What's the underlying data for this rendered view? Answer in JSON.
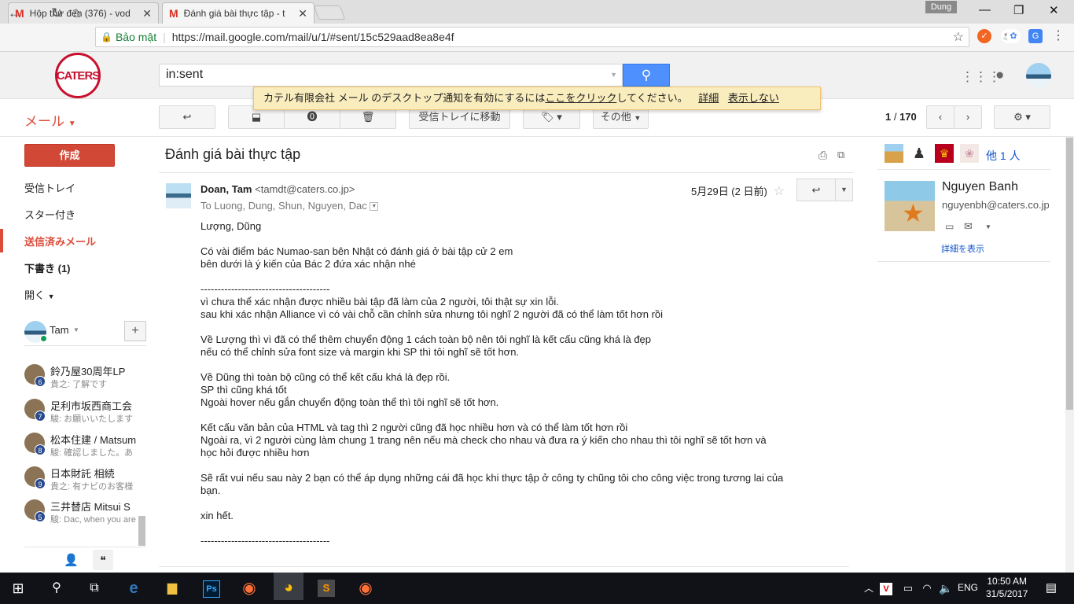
{
  "browser": {
    "tabs": [
      {
        "title": "Hộp thư đến (376) - vod",
        "active": false
      },
      {
        "title": "Đánh giá bài thực tập - t",
        "active": true
      }
    ],
    "user_chip": "Dung",
    "security_label": "Bảo mật",
    "url": "https://mail.google.com/mail/u/1/#sent/15c529aad8ea8e4f"
  },
  "gmail": {
    "logo_text": "CATERS",
    "search_value": "in:sent",
    "notification": {
      "text_before": "カテル有限会社 メール のデスクトップ通知を有効にするには",
      "link": "ここをクリック",
      "text_after": "してください。",
      "details": "詳細",
      "dismiss": "表示しない"
    },
    "mail_menu": "メール",
    "toolbar": {
      "move_inbox": "受信トレイに移動",
      "more": "その他",
      "pager_current": "1",
      "pager_sep": " / ",
      "pager_total": "170"
    },
    "nav": {
      "compose": "作成",
      "inbox": "受信トレイ",
      "starred": "スター付き",
      "sent": "送信済みメール",
      "drafts": "下書き (1)",
      "more": "開く"
    },
    "hangouts": {
      "me": "Tam",
      "chats": [
        {
          "name": "鈴乃屋30周年LP",
          "snippet": "貴之: 了解です",
          "count": "6"
        },
        {
          "name": "足利市坂西商工会",
          "snippet": "駿: お願いいたします",
          "count": "7"
        },
        {
          "name": "松本住建 / Matsum",
          "snippet": "駿: 確認しました。あ",
          "count": "8"
        },
        {
          "name": "日本財託 相続",
          "snippet": "貴之: 有ナビのお客様",
          "count": "9"
        },
        {
          "name": "三井替店 Mitsui S",
          "snippet": "駿: Dac, when you are",
          "count": "5"
        }
      ]
    },
    "message": {
      "subject": "Đánh giá bài thực tập",
      "from_name": "Doan, Tam",
      "from_email": "<tamdt@caters.co.jp>",
      "to": "To Luong, Dung, Shun, Nguyen, Dac",
      "date": "5月29日 (2 日前)",
      "body_lines": [
        "Lượng, Dũng",
        "",
        "Có vài điểm bác Numao-san bên Nhật có đánh giá ở bài tập cử 2 em",
        "bên dưới là ý kiến của Bác 2 đứa xác nhận nhé",
        "",
        "--------------------------------------",
        "vì chưa thể xác nhận được nhiều bài tập đã làm của 2 người, tôi thật sự xin lỗi.",
        "sau khi xác nhận Alliance vì có vài chỗ cần chỉnh sửa nhưng tôi nghĩ 2 người đã có thể làm tốt hơn rồi",
        "",
        "Về Lượng thì vì đã có thể thêm chuyển động 1 cách toàn bộ nên tôi nghĩ là kết cấu cũng khá là đẹp",
        "nếu có thể chỉnh sửa font size và margin khi SP thì tôi nghĩ sẽ tốt hơn.",
        "",
        "Về Dũng thì toàn bộ cũng có thể kết cấu khá là đẹp rồi.",
        "SP thì cũng khá tốt",
        "Ngoài hover nếu gắn chuyển động toàn thể thì tôi nghĩ sẽ tốt hơn.",
        "",
        "Kết cấu văn bản của HTML và tag thì 2 người cũng đã học nhiều hơn và có thể làm tốt hơn rồi",
        "Ngoài ra, vì 2 người cùng làm chung 1 trang nên nếu mà check cho nhau và đưa ra ý kiến cho nhau thì tôi nghĩ sẽ tốt hơn và",
        "học hỏi được nhiều hơn",
        "",
        "Sẽ rất vui nếu sau này 2 bạn có thể áp dụng những cái đã học khi thực tập ở công ty chũng tôi cho công việc trong tương lai của",
        "bạn.",
        "",
        "xin hết.",
        "",
        "--------------------------------------"
      ]
    },
    "people_panel": {
      "more_people": "他 1 人",
      "name": "Nguyen Banh",
      "email": "nguyenbh@caters.co.jp",
      "details_link": "詳細を表示"
    }
  },
  "taskbar": {
    "language": "ENG",
    "time": "10:50 AM",
    "date": "31/5/2017"
  }
}
